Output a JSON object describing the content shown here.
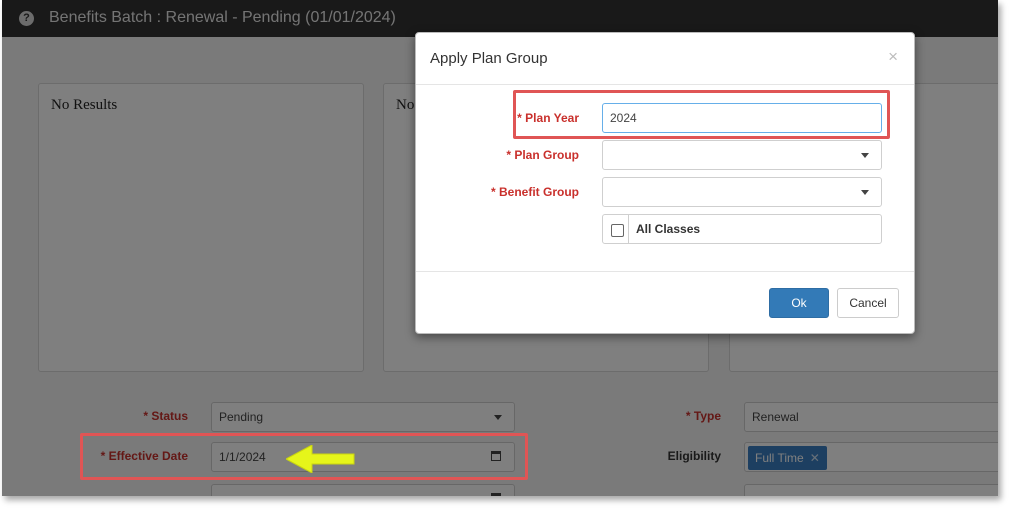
{
  "window": {
    "title": "Benefits Batch : Renewal - Pending (01/01/2024)",
    "help_icon": "?"
  },
  "panels": [
    {
      "text": "No Results"
    },
    {
      "text": "No"
    }
  ],
  "form": {
    "status": {
      "label": "* Status",
      "value": "Pending"
    },
    "effective_date": {
      "label": "* Effective Date",
      "value": "1/1/2024"
    },
    "type": {
      "label": "* Type",
      "value": "Renewal"
    },
    "eligibility": {
      "label": "Eligibility",
      "chip": "Full Time",
      "chip_remove": "✕"
    }
  },
  "modal": {
    "title": "Apply Plan Group",
    "close_glyph": "×",
    "plan_year": {
      "label": "* Plan Year",
      "value": "2024"
    },
    "plan_group": {
      "label": "* Plan Group",
      "value": ""
    },
    "benefit_group": {
      "label": "* Benefit Group",
      "value": ""
    },
    "all_classes": {
      "label": "All Classes",
      "checked": false
    },
    "ok_label": "Ok",
    "cancel_label": "Cancel"
  },
  "colors": {
    "required": "#c9302c",
    "primary": "#337ab7",
    "highlight": "#e05555",
    "arrow": "#e6f51a",
    "titlebar": "#333333"
  }
}
